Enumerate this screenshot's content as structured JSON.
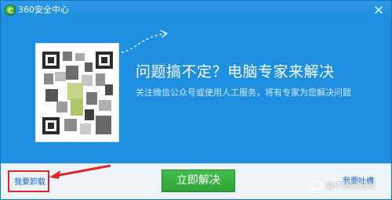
{
  "window": {
    "title": "360安全中心",
    "close_symbol": "×"
  },
  "main": {
    "headline": "问题搞不定？电脑专家来解决",
    "subtitle": "关注微信公众号或使用人工服务，将有专家为您解决问题",
    "qr_code": "blurred"
  },
  "footer": {
    "uninstall_label": "我要卸载",
    "solve_button_label": "立即解决",
    "feedback_label": "我要吐槽"
  },
  "watermark": {
    "text": "@IT精英成长"
  },
  "colors": {
    "window_blue": "#1e8fe0",
    "button_green": "#2ea33a",
    "annotation_red": "#e02626",
    "link_blue": "#1565c0"
  }
}
